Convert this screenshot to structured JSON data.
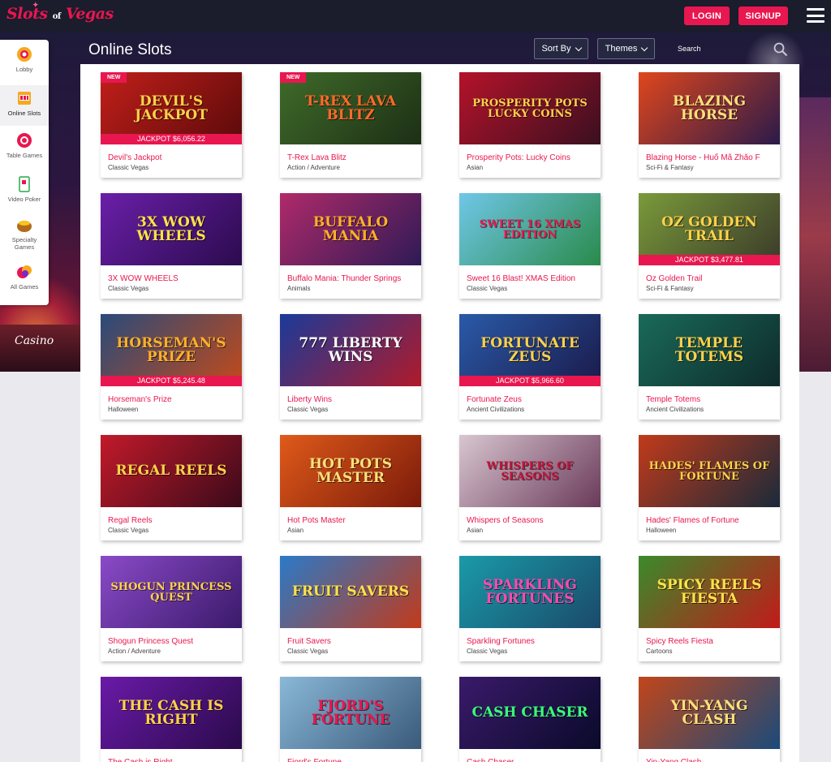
{
  "header": {
    "logo_main": "Slots",
    "logo_of": "of",
    "logo_end": "Vegas",
    "login_label": "LOGIN",
    "signup_label": "SIGNUP"
  },
  "page": {
    "title": "Online Slots",
    "sort_label": "Sort By",
    "themes_label": "Themes",
    "search_placeholder": "Search",
    "hero_sign": "Casino"
  },
  "sidebar": {
    "items": [
      {
        "label": "Lobby",
        "icon": "lobby-icon"
      },
      {
        "label": "Online Slots",
        "icon": "slot-machine-icon"
      },
      {
        "label": "Table Games",
        "icon": "poker-chip-icon"
      },
      {
        "label": "Video Poker",
        "icon": "playing-card-icon"
      },
      {
        "label": "Specialty Games",
        "icon": "specialty-pot-icon"
      },
      {
        "label": "All Games",
        "icon": "all-games-icon"
      }
    ]
  },
  "games": [
    {
      "name": "Devil's Jackpot",
      "category": "Classic Vegas",
      "badge": "NEW",
      "jackpot": "JACKPOT $6,056.22",
      "art": "DEVIL'S JACKPOT",
      "bg1": "#c21f1a",
      "bg2": "#5a0a0a",
      "fg": "#ffd24a"
    },
    {
      "name": "T-Rex Lava Blitz",
      "category": "Action / Adventure",
      "badge": "NEW",
      "jackpot": "",
      "art": "T-REX LAVA BLITZ",
      "bg1": "#3f6b2a",
      "bg2": "#1d2f15",
      "fg": "#ff6a2a"
    },
    {
      "name": "Prosperity Pots: Lucky Coins",
      "category": "Asian",
      "badge": "",
      "jackpot": "",
      "art": "PROSPERITY POTS LUCKY COINS",
      "bg1": "#b5122a",
      "bg2": "#3a1020",
      "fg": "#ffd24a"
    },
    {
      "name": "Blazing Horse - Huổ Mã Zhǎo F",
      "category": "Sci-Fi & Fantasy",
      "badge": "",
      "jackpot": "",
      "art": "BLAZING HORSE",
      "bg1": "#e0461c",
      "bg2": "#2a1a4a",
      "fg": "#ffe07a"
    },
    {
      "name": "3X WOW WHEELS",
      "category": "Classic Vegas",
      "badge": "",
      "jackpot": "",
      "art": "3X WOW WHEELS",
      "bg1": "#6a1fa8",
      "bg2": "#2b0b4e",
      "fg": "#ffe24a"
    },
    {
      "name": "Buffalo Mania: Thunder Springs",
      "category": "Animals",
      "badge": "",
      "jackpot": "",
      "art": "BUFFALO MANIA",
      "bg1": "#b02a6a",
      "bg2": "#2e1a55",
      "fg": "#ffb02a"
    },
    {
      "name": "Sweet 16 Blast! XMAS Edition",
      "category": "Classic Vegas",
      "badge": "",
      "jackpot": "",
      "art": "SWEET 16 XMAS EDITION",
      "bg1": "#6fc7e8",
      "bg2": "#2a8a4a",
      "fg": "#e8174f"
    },
    {
      "name": "Oz Golden Trail",
      "category": "Sci-Fi & Fantasy",
      "badge": "",
      "jackpot": "JACKPOT $3,477.81",
      "art": "OZ GOLDEN TRAIL",
      "bg1": "#7a9a3a",
      "bg2": "#3a3a2a",
      "fg": "#ffd24a"
    },
    {
      "name": "Horseman's Prize",
      "category": "Halloween",
      "badge": "",
      "jackpot": "JACKPOT $5,245.48",
      "art": "HORSEMAN'S PRIZE",
      "bg1": "#2a4a7a",
      "bg2": "#c24a1a",
      "fg": "#ffb02a"
    },
    {
      "name": "Liberty Wins",
      "category": "Classic Vegas",
      "badge": "",
      "jackpot": "",
      "art": "777 LIBERTY WINS",
      "bg1": "#1a3a9a",
      "bg2": "#b01a2a",
      "fg": "#ffffff"
    },
    {
      "name": "Fortunate Zeus",
      "category": "Ancient Civilizations",
      "badge": "",
      "jackpot": "JACKPOT $5,966.60",
      "art": "FORTUNATE ZEUS",
      "bg1": "#2a5aa8",
      "bg2": "#1a1a4a",
      "fg": "#ffd24a"
    },
    {
      "name": "Temple Totems",
      "category": "Ancient Civilizations",
      "badge": "",
      "jackpot": "",
      "art": "TEMPLE TOTEMS",
      "bg1": "#1a6a5a",
      "bg2": "#0e2a2a",
      "fg": "#ffd24a"
    },
    {
      "name": "Regal Reels",
      "category": "Classic Vegas",
      "badge": "",
      "jackpot": "",
      "art": "REGAL REELS",
      "bg1": "#c21a2a",
      "bg2": "#3a0a1a",
      "fg": "#ffd24a"
    },
    {
      "name": "Hot Pots Master",
      "category": "Asian",
      "badge": "",
      "jackpot": "",
      "art": "HOT POTS MASTER",
      "bg1": "#e05a1a",
      "bg2": "#7a1a0a",
      "fg": "#ffe07a"
    },
    {
      "name": "Whispers of Seasons",
      "category": "Asian",
      "badge": "",
      "jackpot": "",
      "art": "WHISPERS OF SEASONS",
      "bg1": "#d8c6d0",
      "bg2": "#6a3a5a",
      "fg": "#c2123a"
    },
    {
      "name": "Hades' Flames of Fortune",
      "category": "Halloween",
      "badge": "",
      "jackpot": "",
      "art": "HADES' FLAMES OF FORTUNE",
      "bg1": "#c23a1a",
      "bg2": "#1a2a3a",
      "fg": "#ffd24a"
    },
    {
      "name": "Shogun Princess Quest",
      "category": "Action / Adventure",
      "badge": "",
      "jackpot": "",
      "art": "SHOGUN PRINCESS QUEST",
      "bg1": "#8a4ac8",
      "bg2": "#3a1a6a",
      "fg": "#ffd24a"
    },
    {
      "name": "Fruit Savers",
      "category": "Classic Vegas",
      "badge": "",
      "jackpot": "",
      "art": "FRUIT SAVERS",
      "bg1": "#2a7ac8",
      "bg2": "#c23a1a",
      "fg": "#ffe24a"
    },
    {
      "name": "Sparkling Fortunes",
      "category": "Classic Vegas",
      "badge": "",
      "jackpot": "",
      "art": "SPARKLING FORTUNES",
      "bg1": "#1a9aa8",
      "bg2": "#1a4a6a",
      "fg": "#ff4ab0"
    },
    {
      "name": "Spicy Reels Fiesta",
      "category": "Cartoons",
      "badge": "",
      "jackpot": "",
      "art": "SPICY REELS FIESTA",
      "bg1": "#3a8a2a",
      "bg2": "#c21a1a",
      "fg": "#ffe24a"
    },
    {
      "name": "The Cash is Right",
      "category": "",
      "badge": "",
      "jackpot": "",
      "art": "THE CASH IS RIGHT",
      "bg1": "#6a1aa8",
      "bg2": "#2a0a4a",
      "fg": "#ffd24a"
    },
    {
      "name": "Fjord's Fortune",
      "category": "",
      "badge": "",
      "jackpot": "",
      "art": "FJORD'S FORTUNE",
      "bg1": "#8ab8d8",
      "bg2": "#3a5a7a",
      "fg": "#e8174f"
    },
    {
      "name": "Cash Chaser",
      "category": "",
      "badge": "",
      "jackpot": "",
      "art": "CASH CHASER",
      "bg1": "#3a1a6a",
      "bg2": "#0a0a2a",
      "fg": "#3aff7a"
    },
    {
      "name": "Yin-Yang Clash",
      "category": "",
      "badge": "",
      "jackpot": "",
      "art": "YIN-YANG CLASH",
      "bg1": "#c2461a",
      "bg2": "#1a4a7a",
      "fg": "#ffe07a"
    }
  ]
}
